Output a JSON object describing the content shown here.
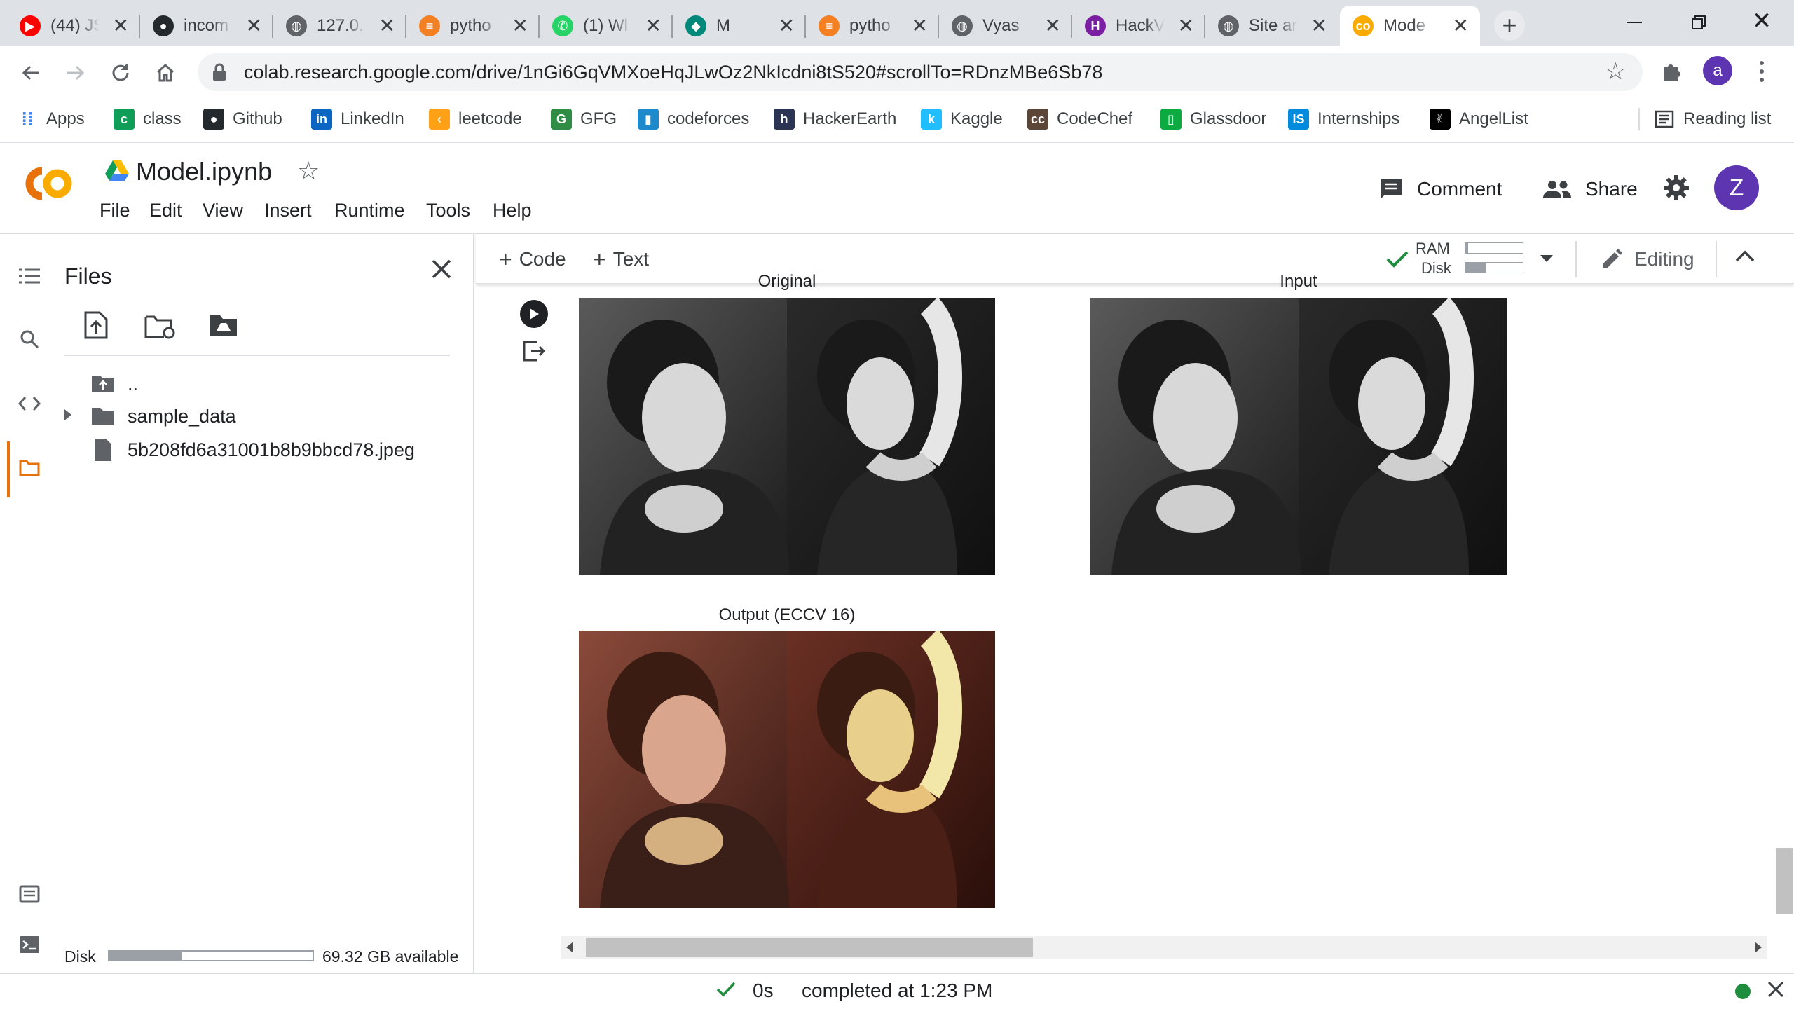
{
  "tabs": [
    {
      "title": "(44) JS",
      "favicon": "youtube-icon",
      "color": "#ff0000"
    },
    {
      "title": "incom",
      "favicon": "github-icon",
      "color": "#24292e"
    },
    {
      "title": "127.0.",
      "favicon": "globe-icon",
      "color": "#5f6368"
    },
    {
      "title": "pytho",
      "favicon": "stackoverflow-icon",
      "color": "#f48024"
    },
    {
      "title": "(1) Wl",
      "favicon": "whatsapp-icon",
      "color": "#25d366"
    },
    {
      "title": "M",
      "favicon": "meet-icon",
      "color": "#00897b"
    },
    {
      "title": "pytho",
      "favicon": "stackoverflow-icon",
      "color": "#f48024"
    },
    {
      "title": "Vyas",
      "favicon": "globe-icon",
      "color": "#5f6368"
    },
    {
      "title": "HackV",
      "favicon": "hackerrank-icon",
      "color": "#7b1fa2"
    },
    {
      "title": "Site ar",
      "favicon": "globe-icon",
      "color": "#5f6368"
    },
    {
      "title": "Mode",
      "favicon": "colab-icon",
      "color": "#f9ab00"
    }
  ],
  "address": {
    "url": "colab.research.google.com/drive/1nGi6GqVMXoeHqJLwOz2NkIcdni8tS520#scrollTo=RDnzMBe6Sb78"
  },
  "profile_letter": "a",
  "bookmarks": [
    {
      "label": "Apps",
      "icon": "apps-grid-icon"
    },
    {
      "label": "class",
      "icon": "classroom-icon"
    },
    {
      "label": "Github",
      "icon": "github-icon"
    },
    {
      "label": "LinkedIn",
      "icon": "linkedin-icon"
    },
    {
      "label": "leetcode",
      "icon": "leetcode-icon"
    },
    {
      "label": "GFG",
      "icon": "gfg-icon"
    },
    {
      "label": "codeforces",
      "icon": "codeforces-icon"
    },
    {
      "label": "HackerEarth",
      "icon": "hackerearth-icon"
    },
    {
      "label": "Kaggle",
      "icon": "kaggle-icon"
    },
    {
      "label": "CodeChef",
      "icon": "codechef-icon"
    },
    {
      "label": "Glassdoor",
      "icon": "glassdoor-icon"
    },
    {
      "label": "Internships",
      "icon": "internshala-icon"
    },
    {
      "label": "AngelList",
      "icon": "angellist-icon"
    }
  ],
  "reading_list": "Reading list",
  "colab": {
    "logo": "CO",
    "notebook_title": "Model.ipynb",
    "menu": [
      "File",
      "Edit",
      "View",
      "Insert",
      "Runtime",
      "Tools",
      "Help"
    ],
    "comment_label": "Comment",
    "share_label": "Share",
    "user_letter": "Z"
  },
  "files_panel": {
    "title": "Files",
    "parent": "..",
    "items": [
      {
        "name": "sample_data",
        "type": "folder"
      },
      {
        "name": "5b208fd6a31001b8b9bbcd78.jpeg",
        "type": "file"
      }
    ],
    "disk_label": "Disk",
    "disk_available": "69.32 GB available",
    "disk_used_fraction": 0.36
  },
  "cell_toolbar": {
    "code_label": "Code",
    "text_label": "Text",
    "ram_label": "RAM",
    "disk_label": "Disk",
    "ram_fraction": 0.05,
    "disk_fraction": 0.35,
    "editing_label": "Editing"
  },
  "output": {
    "captions": [
      "Original",
      "Input",
      "Output (ECCV 16)"
    ]
  },
  "status": {
    "duration": "0s",
    "completed": "completed at 1:23 PM"
  },
  "colors": {
    "accent_orange": "#e8710a",
    "user_purple": "#5e35b1",
    "check_green": "#1e8e3e"
  }
}
